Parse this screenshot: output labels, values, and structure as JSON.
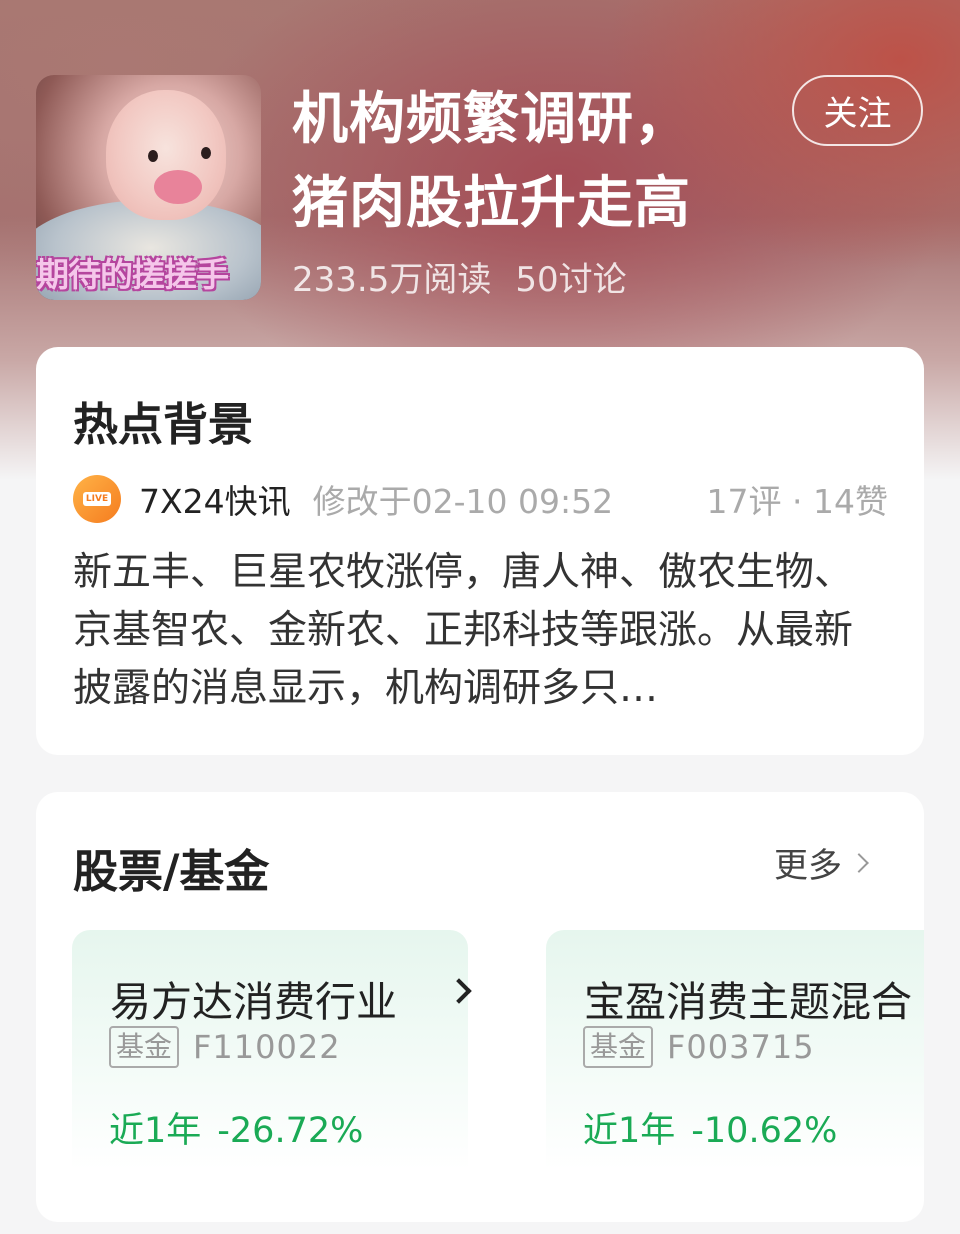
{
  "topic": {
    "title": "机构频繁调研，猪肉股拉升走高",
    "cover_caption": "期待的搓搓手",
    "reads": "233.5万阅读",
    "discussions": "50讨论",
    "follow_label": "关注"
  },
  "hot_background": {
    "heading": "热点背景",
    "source_icon": "live-icon",
    "source_icon_text": "LIVE",
    "source_name": "7X24快讯",
    "modified": "修改于02-10 09:52",
    "stats": "17评 · 14赞",
    "summary": "新五丰、巨星农牧涨停，唐人神、傲农生物、京基智农、金新农、正邦科技等跟涨。从最新披露的消息显示，机构调研多只…"
  },
  "funds_section": {
    "heading": "股票/基金",
    "more_label": "更多",
    "items": [
      {
        "name": "易方达消费行业",
        "tag": "基金",
        "code": "F110022",
        "period": "近1年",
        "change": "-26.72%"
      },
      {
        "name": "宝盈消费主题混合",
        "tag": "基金",
        "code": "F003715",
        "period": "近1年",
        "change": "-10.62%"
      }
    ],
    "accent_color": "#1aaa55"
  }
}
